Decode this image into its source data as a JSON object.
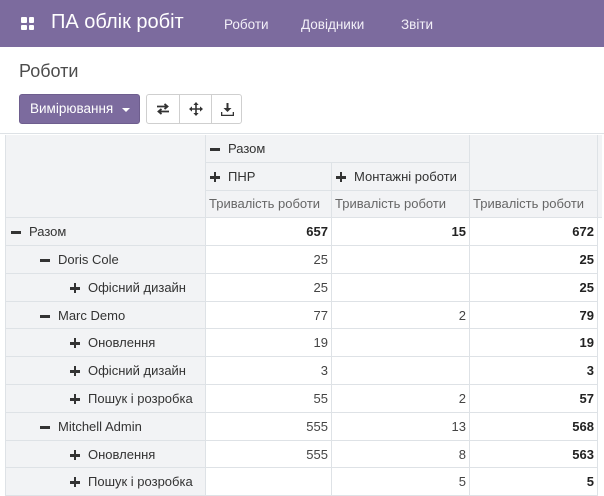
{
  "app": {
    "title": "ПА облік робіт"
  },
  "menu": [
    "Роботи",
    "Довідники",
    "Звіти"
  ],
  "breadcrumb": "Роботи",
  "toolbar": {
    "measures_label": "Вимірювання"
  },
  "pivot": {
    "col_group_total": "Разом",
    "col_groups": [
      "ПНР",
      "Монтажні роботи"
    ],
    "measure": "Тривалість роботи",
    "rows": [
      {
        "label": "Разом",
        "sign": "minus",
        "values": [
          "657",
          "15",
          "672"
        ]
      },
      {
        "label": "Doris Cole",
        "sign": "minus",
        "values": [
          "25",
          "",
          "25"
        ]
      },
      {
        "label": "Офісний дизайн",
        "sign": "plus",
        "values": [
          "25",
          "",
          "25"
        ]
      },
      {
        "label": "Marc Demo",
        "sign": "minus",
        "values": [
          "77",
          "2",
          "79"
        ]
      },
      {
        "label": "Оновлення",
        "sign": "plus",
        "values": [
          "19",
          "",
          "19"
        ]
      },
      {
        "label": "Офісний дизайн",
        "sign": "plus",
        "values": [
          "3",
          "",
          "3"
        ]
      },
      {
        "label": "Пошук і розробка",
        "sign": "plus",
        "values": [
          "55",
          "2",
          "57"
        ]
      },
      {
        "label": "Mitchell Admin",
        "sign": "minus",
        "values": [
          "555",
          "13",
          "568"
        ]
      },
      {
        "label": "Оновлення",
        "sign": "plus",
        "values": [
          "555",
          "8",
          "563"
        ]
      },
      {
        "label": "Пошук і розробка",
        "sign": "plus",
        "values": [
          "",
          "5",
          "5"
        ]
      }
    ]
  }
}
